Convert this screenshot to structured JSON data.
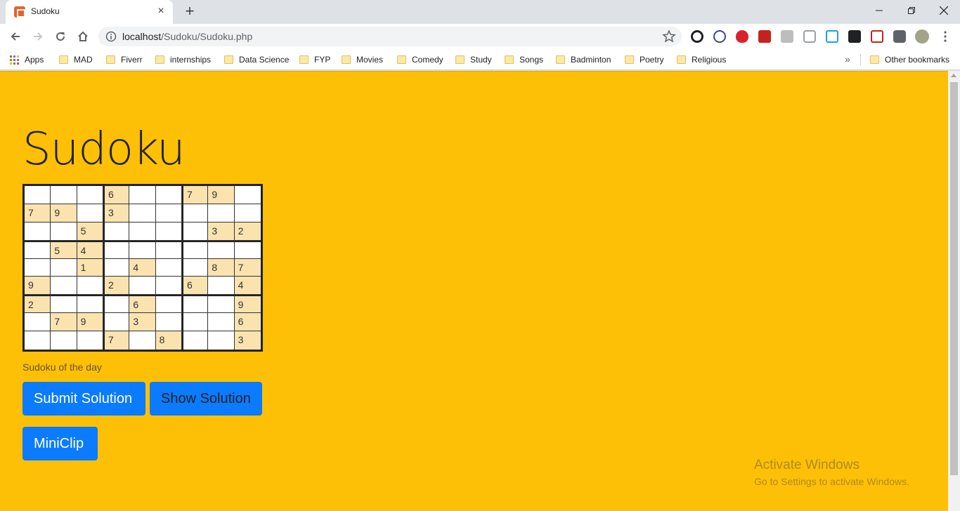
{
  "browser": {
    "tab_title": "Sudoku",
    "tab_close": "×",
    "new_tab": "+",
    "url_host": "localhost",
    "url_path": "/Sudoku/Sudoku.php",
    "bookmarks": [
      "Apps",
      "MAD",
      "Fiverr",
      "internships",
      "Data Science",
      "FYP",
      "Movies",
      "Comedy",
      "Study",
      "Songs",
      "Badminton",
      "Poetry",
      "Religious"
    ],
    "overflow_chevron": "»",
    "other_bookmarks": "Other bookmarks"
  },
  "page": {
    "title": "Sudoku",
    "caption": "Sudoku of the day",
    "buttons": {
      "submit": "Submit Solution",
      "show": "Show Solution",
      "miniclip": "MiniClip"
    },
    "watermark": {
      "title": "Activate Windows",
      "subtitle": "Go to Settings to activate Windows."
    },
    "grid": [
      [
        "",
        "",
        "",
        "6",
        "",
        "",
        "7",
        "9",
        ""
      ],
      [
        "7",
        "9",
        "",
        "3",
        "",
        "",
        "",
        "",
        ""
      ],
      [
        "",
        "",
        "5",
        "",
        "",
        "",
        "",
        "3",
        "2"
      ],
      [
        "",
        "5",
        "4",
        "",
        "",
        "",
        "",
        "",
        ""
      ],
      [
        "",
        "",
        "1",
        "",
        "4",
        "",
        "",
        "8",
        "7"
      ],
      [
        "9",
        "",
        "",
        "2",
        "",
        "",
        "6",
        "",
        "4"
      ],
      [
        "2",
        "",
        "",
        "",
        "6",
        "",
        "",
        "",
        "9"
      ],
      [
        "",
        "7",
        "9",
        "",
        "3",
        "",
        "",
        "",
        "6"
      ],
      [
        "",
        "",
        "",
        "7",
        "",
        "8",
        "",
        "",
        "3"
      ]
    ]
  },
  "colors": {
    "page_bg": "#fdc006",
    "button_bg": "#0b7bff",
    "given_cell": "#fbe3b0"
  }
}
